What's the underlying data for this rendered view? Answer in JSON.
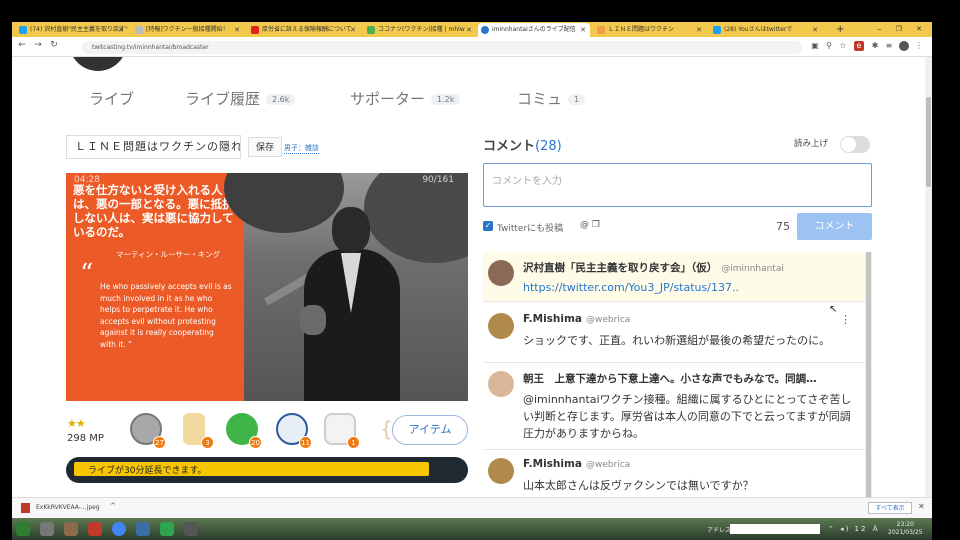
{
  "browser": {
    "tabs": [
      {
        "label": "(74) 沢村直樹\"民主主義を取り戻す\"",
        "color": "#1da1f2"
      },
      {
        "label": "[特報]ワクチン一般接種開始！",
        "color": "#bbbbbb"
      },
      {
        "label": "厚労省に訴える保険報酬について",
        "color": "#e62117"
      },
      {
        "label": "ココナツ(ワクチン)接種 | mhlw",
        "color": "#4caf50"
      },
      {
        "label": "iminnhantaiさんのライブ配信",
        "color": "#2a75c9"
      },
      {
        "label": "ＬＩＮＥ問題はワクチン",
        "color": "#f2994a"
      },
      {
        "label": "(28) Youさんはtwitterで",
        "color": "#1da1f2"
      }
    ],
    "new_tab": "+",
    "window_controls": "‒ ❐ ✕",
    "url": "twitcasting.tv/iminnhantai/broadcaster",
    "nav_icons": [
      "←",
      "→",
      "↻"
    ]
  },
  "profile_tabs": [
    {
      "label": "ライブ",
      "count": ""
    },
    {
      "label": "ライブ履歴",
      "count": "2.6k"
    },
    {
      "label": "サポーター",
      "count": "1.2k"
    },
    {
      "label": "コミュ",
      "count": "1"
    }
  ],
  "broadcast": {
    "title": "ＬＩＮＥ問題はワクチンの隠れ蓑",
    "save_label": "保存",
    "genre_link": "男子：雑談",
    "elapsed": "04:28",
    "viewers": "90/161",
    "jp_quote": "悪を仕方ないと受け入れる人は、悪の一部となる。悪に抵抗しない人は、実は悪に協力しているのだ。",
    "jp_author": "マーティン・ルーサー・キング",
    "quote_mark": "“",
    "en_quote": "He who passively accepts evil is as much involved in it as he who helps to perpetrate it. He who accepts evil without protesting against it is really cooperating with it. \""
  },
  "support": {
    "stars": "★★",
    "mp": "298 MP",
    "items": [
      {
        "name": "coin-item",
        "count": "27",
        "color": "#a8a8a8"
      },
      {
        "name": "tea-item",
        "count": "3",
        "color": "#f2d9a0"
      },
      {
        "name": "puyo-item",
        "count": "20",
        "color": "#3fb548"
      },
      {
        "name": "penguin-item",
        "count": "11",
        "color": "#e8eef5"
      },
      {
        "name": "rabbit-item",
        "count": "1",
        "color": "#f3f3f3"
      }
    ],
    "item_button": "アイテム",
    "bracket": "{",
    "progress_text": "ライブが30分延長できます。",
    "progress": 0.92
  },
  "comments": {
    "title": "コメント",
    "count": "(28)",
    "readout_label": "読み上げ",
    "input_placeholder": "コメントを入力",
    "twitter_label": "Twitterにも投稿",
    "twitter_icons": "@ ❐",
    "char_count": "75",
    "submit_label": "コメント",
    "kebab": "⋮",
    "list": [
      {
        "name": "沢村直樹「民主主義を取り戻す会」（仮）",
        "handle": "@iminnhantai",
        "text": "https://twitter.com/You3_JP/status/137..",
        "avatar": "#8a6a55"
      },
      {
        "name": "F.Mishima",
        "handle": "@webrica",
        "text": "ショックです、正直。れいわ新選組が最後の希望だったのに。",
        "avatar": "#b08a4a"
      },
      {
        "name": "朝王　上意下達から下意上達へ。小さな声でもみなで。同調…",
        "handle": "",
        "text": "@iminnhantaiワクチン接種。組織に属するひとにとってさぞ苦しい判断と存じます。厚労省は本人の同意の下でと云ってますが同調圧力がありますからね。",
        "avatar": "#d8b898"
      },
      {
        "name": "F.Mishima",
        "handle": "@webrica",
        "text": "山本太郎さんは反ヴァクシンでは無いですか？",
        "avatar": "#b08a4a"
      }
    ]
  },
  "download": {
    "file": "ExKkRVKVEAA-...jpeg",
    "arrow": "^",
    "show_all": "すべて表示",
    "close": "✕"
  },
  "taskbar": {
    "address_label": "アドレス",
    "tray": "⌃ ◂) 12 Ａ",
    "time": "23:20",
    "date": "2021/03/25"
  }
}
